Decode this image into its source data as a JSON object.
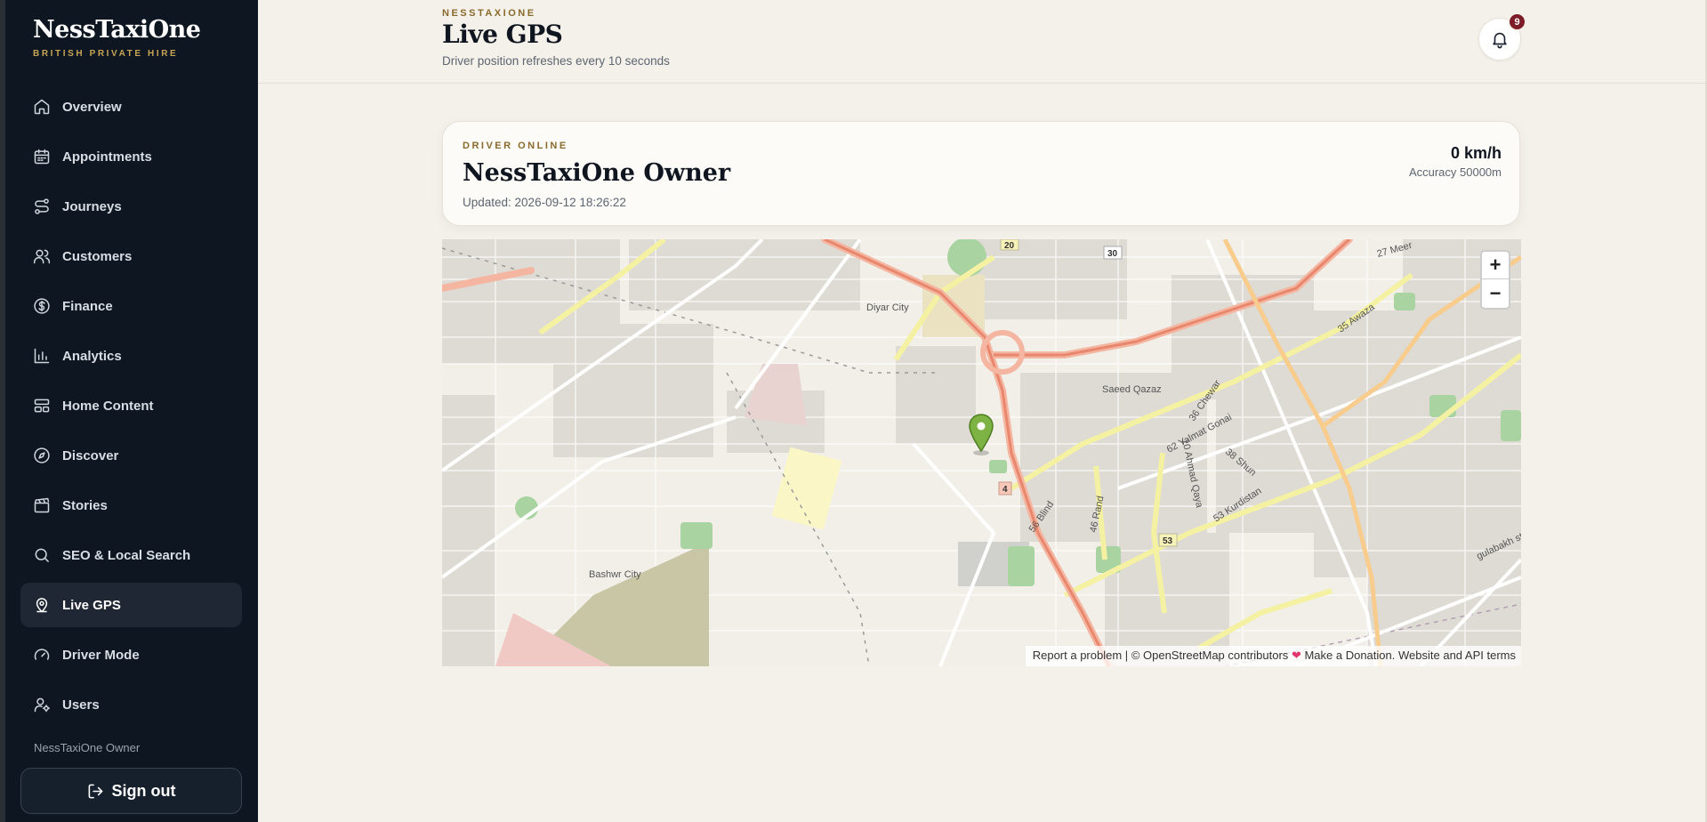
{
  "brand": {
    "name": "NessTaxiOne",
    "subtitle": "BRITISH PRIVATE HIRE"
  },
  "sidebar": {
    "items": [
      {
        "label": "Overview",
        "icon": "home-icon"
      },
      {
        "label": "Appointments",
        "icon": "calendar-icon"
      },
      {
        "label": "Journeys",
        "icon": "route-icon"
      },
      {
        "label": "Customers",
        "icon": "users-icon"
      },
      {
        "label": "Finance",
        "icon": "dollar-icon"
      },
      {
        "label": "Analytics",
        "icon": "bar-chart-icon"
      },
      {
        "label": "Home Content",
        "icon": "layout-icon"
      },
      {
        "label": "Discover",
        "icon": "compass-icon"
      },
      {
        "label": "Stories",
        "icon": "clapperboard-icon"
      },
      {
        "label": "SEO & Local Search",
        "icon": "search-icon"
      },
      {
        "label": "Live GPS",
        "icon": "map-pin-icon",
        "active": true
      },
      {
        "label": "Driver Mode",
        "icon": "gauge-icon"
      },
      {
        "label": "Users",
        "icon": "user-cog-icon"
      }
    ],
    "owner": "NessTaxiOne Owner",
    "signout_label": "Sign out"
  },
  "header": {
    "kicker": "NESSTAXIONE",
    "title": "Live GPS",
    "subtitle": "Driver position refreshes every 10 seconds",
    "notification_count": "9"
  },
  "driver": {
    "status": "DRIVER ONLINE",
    "name": "NessTaxiOne Owner",
    "updated": "Updated: 2026-09-12 18:26:22",
    "speed": "0 km/h",
    "accuracy": "Accuracy 50000m"
  },
  "map": {
    "zoom_in": "+",
    "zoom_out": "−",
    "attribution": {
      "report": "Report a problem",
      "separator": "|",
      "osm": "© OpenStreetMap contributors",
      "donate": "Make a Donation.",
      "terms": "Website and API terms"
    },
    "labels": {
      "diyar_city": "Diyar City",
      "saeed_qazaz": "Saeed Qazaz",
      "yalmat_gonai": "62 Yalmat Gonai",
      "kurdistan": "53 Kurdistan",
      "bashwr_city": "Bashwr City",
      "meer": "27 Meer",
      "chewar": "36 Chewar",
      "rand": "46 Rand",
      "shun": "38 Shun",
      "awaza": "35 Awaza",
      "ahmad_qaya": "10 Ahmad Qaya",
      "blind": "56 Blind",
      "gulabakh": "gulabakh st",
      "road_53": "53",
      "road_4": "4",
      "road_30": "30",
      "road_20": "20"
    }
  },
  "colors": {
    "sidebar_bg": "#0d1621",
    "accent_gold": "#8a6a2c",
    "badge_red": "#7d1d2a",
    "page_bg": "#f4f1ea",
    "pin_green": "#7cb342"
  }
}
